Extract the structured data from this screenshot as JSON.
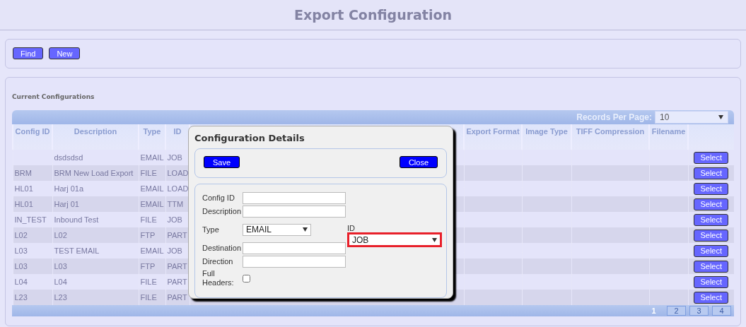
{
  "page_title": "Export Configuration",
  "toolbar": {
    "buttons": [
      "Find",
      "New"
    ]
  },
  "section_title": "Current Configurations",
  "records_per_page": {
    "label": "Records Per Page:",
    "value": "10"
  },
  "table": {
    "columns": [
      "Config ID",
      "Description",
      "Type",
      "ID",
      "Export Format",
      "Image Type",
      "TIFF Compression",
      "Filename"
    ],
    "rows": [
      {
        "description": "dsdsdsd",
        "type": "EMAIL",
        "id": "JOB",
        "action": "Select"
      },
      {
        "config_id": "BRM",
        "description": "BRM New Load Export",
        "type": "FILE",
        "id": "LOAD",
        "action": "Select"
      },
      {
        "config_id": "HL01",
        "description": "Harj 01a",
        "type": "EMAIL",
        "id": "LOAD",
        "action": "Select"
      },
      {
        "config_id": "HL01",
        "description": "Harj 01",
        "type": "EMAIL",
        "id": "TTM",
        "action": "Select"
      },
      {
        "config_id": "IN_TEST",
        "description": "Inbound Test",
        "type": "FILE",
        "id": "JOB",
        "action": "Select"
      },
      {
        "config_id": "L02",
        "description": "L02",
        "type": "FTP",
        "id": "PART",
        "action": "Select"
      },
      {
        "config_id": "L03",
        "description": "TEST EMAIL",
        "type": "EMAIL",
        "id": "JOB",
        "action": "Select"
      },
      {
        "config_id": "L03",
        "description": "L03",
        "type": "FTP",
        "id": "PART",
        "action": "Select"
      },
      {
        "config_id": "L04",
        "description": "L04",
        "type": "FILE",
        "id": "PART",
        "action": "Select"
      },
      {
        "config_id": "L23",
        "description": "L23",
        "type": "FILE",
        "id": "PART",
        "action": "Select"
      }
    ]
  },
  "pagination": [
    {
      "label": "1",
      "selected": true
    },
    {
      "label": "2",
      "selected": false
    },
    {
      "label": "3",
      "selected": false
    },
    {
      "label": "4",
      "selected": false
    }
  ],
  "dialog": {
    "title": "Configuration Details",
    "buttons": [
      "Save",
      "Close"
    ],
    "fields": {
      "config_id": {
        "label": "Config ID"
      },
      "description": {
        "label": "Description"
      },
      "type": {
        "label": "Type",
        "value": "EMAIL"
      },
      "destination": {
        "label": "Destination"
      },
      "direction": {
        "label": "Direction"
      },
      "full_headers": {
        "label": "Full Headers:",
        "checked": false
      },
      "id": {
        "label": "ID",
        "value": "JOB",
        "highlighted": true
      }
    }
  }
}
